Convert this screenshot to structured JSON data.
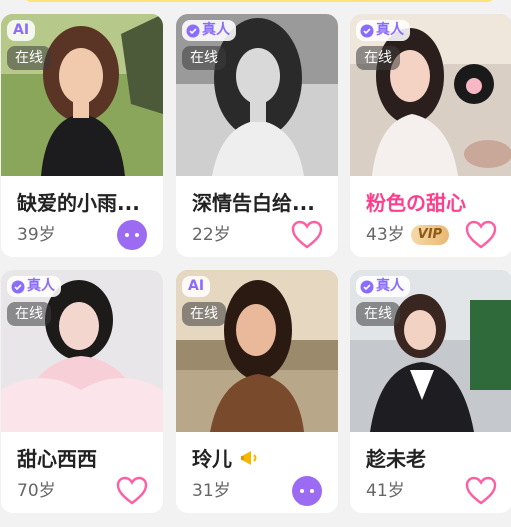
{
  "colors": {
    "background": "#f2f2f2",
    "accent_purple": "#8a6cff",
    "pink_name": "#ff3f8e",
    "heart": "#ff5fa2",
    "vip_gold": "#e9b872"
  },
  "cards": [
    {
      "name": "缺爱的小雨...",
      "age": "39岁",
      "badge": "AI",
      "online": "在线",
      "action": "chat-bubble-icon"
    },
    {
      "name": "深情告白给...",
      "age": "22岁",
      "badge": "真人",
      "online": "在线",
      "action": "heart-icon"
    },
    {
      "name": "粉色の甜心",
      "age": "43岁",
      "badge": "真人",
      "online": "在线",
      "vip": "VIP",
      "action": "heart-icon"
    },
    {
      "name": "甜心西西",
      "age": "70岁",
      "badge": "真人",
      "online": "在线",
      "action": "heart-icon"
    },
    {
      "name": "玲儿",
      "age": "31岁",
      "badge": "AI",
      "online": "在线",
      "action": "chat-bubble-icon",
      "emoji": "megaphone-icon"
    },
    {
      "name": "趁未老",
      "age": "41岁",
      "badge": "真人",
      "online": "在线",
      "action": "heart-icon"
    }
  ]
}
